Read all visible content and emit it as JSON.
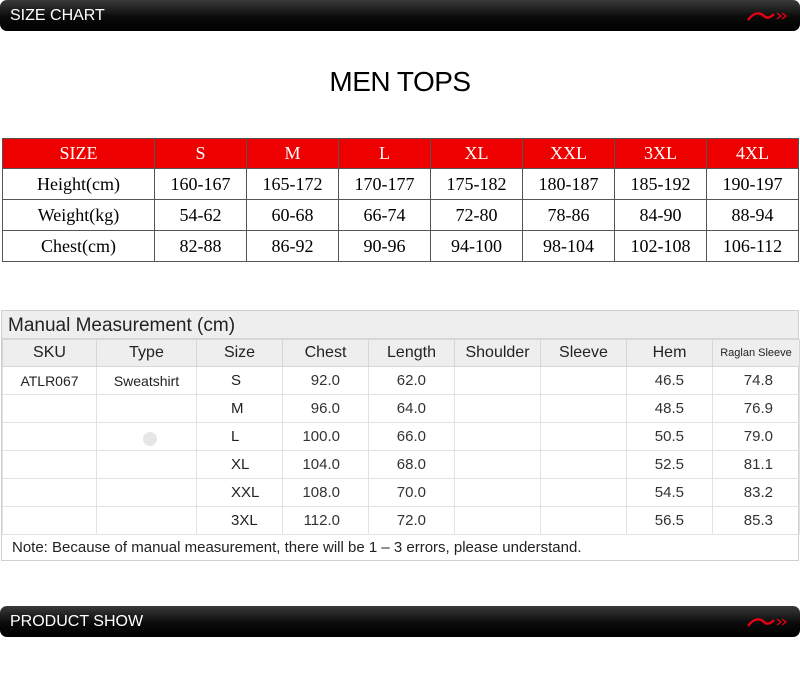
{
  "banner_top": {
    "label": "SIZE CHART"
  },
  "banner_bottom": {
    "label": "PRODUCT SHOW"
  },
  "colors": {
    "header_red": "#ee0000",
    "banner_black": "#000000",
    "logo_red": "#e60012"
  },
  "main_title": "MEN TOPS",
  "size_table": {
    "headers": [
      "SIZE",
      "S",
      "M",
      "L",
      "XL",
      "XXL",
      "3XL",
      "4XL"
    ],
    "rows": [
      [
        "Height(cm)",
        "160-167",
        "165-172",
        "170-177",
        "175-182",
        "180-187",
        "185-192",
        "190-197"
      ],
      [
        "Weight(kg)",
        "54-62",
        "60-68",
        "66-74",
        "72-80",
        "78-86",
        "84-90",
        "88-94"
      ],
      [
        "Chest(cm)",
        "82-88",
        "86-92",
        "90-96",
        "94-100",
        "98-104",
        "102-108",
        "106-112"
      ]
    ]
  },
  "manual": {
    "title": "Manual Measurement (cm)",
    "headers": [
      "SKU",
      "Type",
      "Size",
      "Chest",
      "Length",
      "Shoulder",
      "Sleeve",
      "Hem",
      "Raglan Sleeve"
    ],
    "rows": [
      [
        "ATLR067",
        "Sweatshirt",
        "S",
        "92.0",
        "62.0",
        "",
        "",
        "46.5",
        "74.8"
      ],
      [
        "",
        "",
        "M",
        "96.0",
        "64.0",
        "",
        "",
        "48.5",
        "76.9"
      ],
      [
        "",
        "",
        "L",
        "100.0",
        "66.0",
        "",
        "",
        "50.5",
        "79.0"
      ],
      [
        "",
        "",
        "XL",
        "104.0",
        "68.0",
        "",
        "",
        "52.5",
        "81.1"
      ],
      [
        "",
        "",
        "XXL",
        "108.0",
        "70.0",
        "",
        "",
        "54.5",
        "83.2"
      ],
      [
        "",
        "",
        "3XL",
        "112.0",
        "72.0",
        "",
        "",
        "56.5",
        "85.3"
      ]
    ],
    "note": "Note: Because of manual measurement, there will be 1 – 3 errors, please understand."
  }
}
